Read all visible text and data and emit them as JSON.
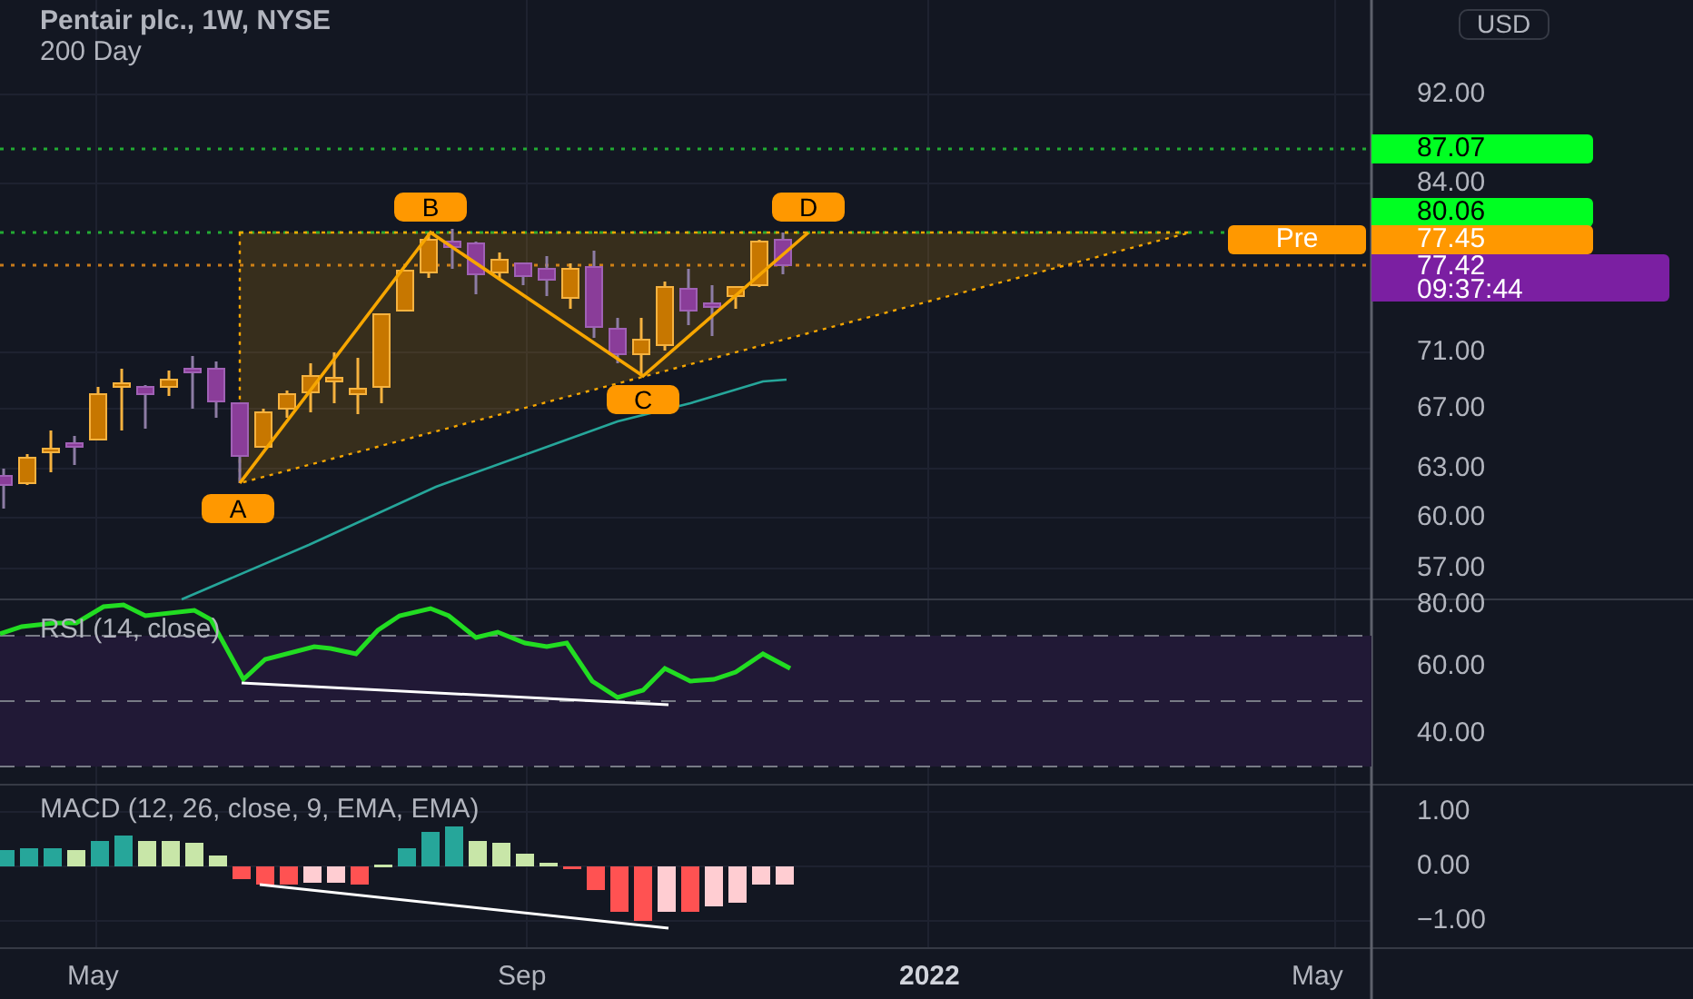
{
  "header": {
    "title": "Pentair plc., 1W, NYSE",
    "subtitle": "200 Day"
  },
  "currency": "USD",
  "price_axis": [
    "92.00",
    "84.00",
    "71.00",
    "67.00",
    "63.00",
    "60.00",
    "57.00"
  ],
  "price_tags": [
    {
      "kind": "level",
      "text": "87.07"
    },
    {
      "kind": "level",
      "text": "80.06"
    },
    {
      "kind": "session",
      "label": "Pre",
      "text": "77.45"
    },
    {
      "kind": "last",
      "text": "77.42",
      "countdown": "09:37:44"
    }
  ],
  "pattern_points": [
    "A",
    "B",
    "C",
    "D"
  ],
  "rsi": {
    "label": "RSI (14, close)",
    "axis": [
      "80.00",
      "60.00",
      "40.00"
    ]
  },
  "macd": {
    "label": "MACD (12, 26, close, 9, EMA, EMA)",
    "axis": [
      "1.00",
      "0.00",
      "−1.00"
    ]
  },
  "time_axis": [
    {
      "text": "May",
      "bold": false
    },
    {
      "text": "Sep",
      "bold": false
    },
    {
      "text": "2022",
      "bold": true
    },
    {
      "text": "May",
      "bold": false
    }
  ]
}
